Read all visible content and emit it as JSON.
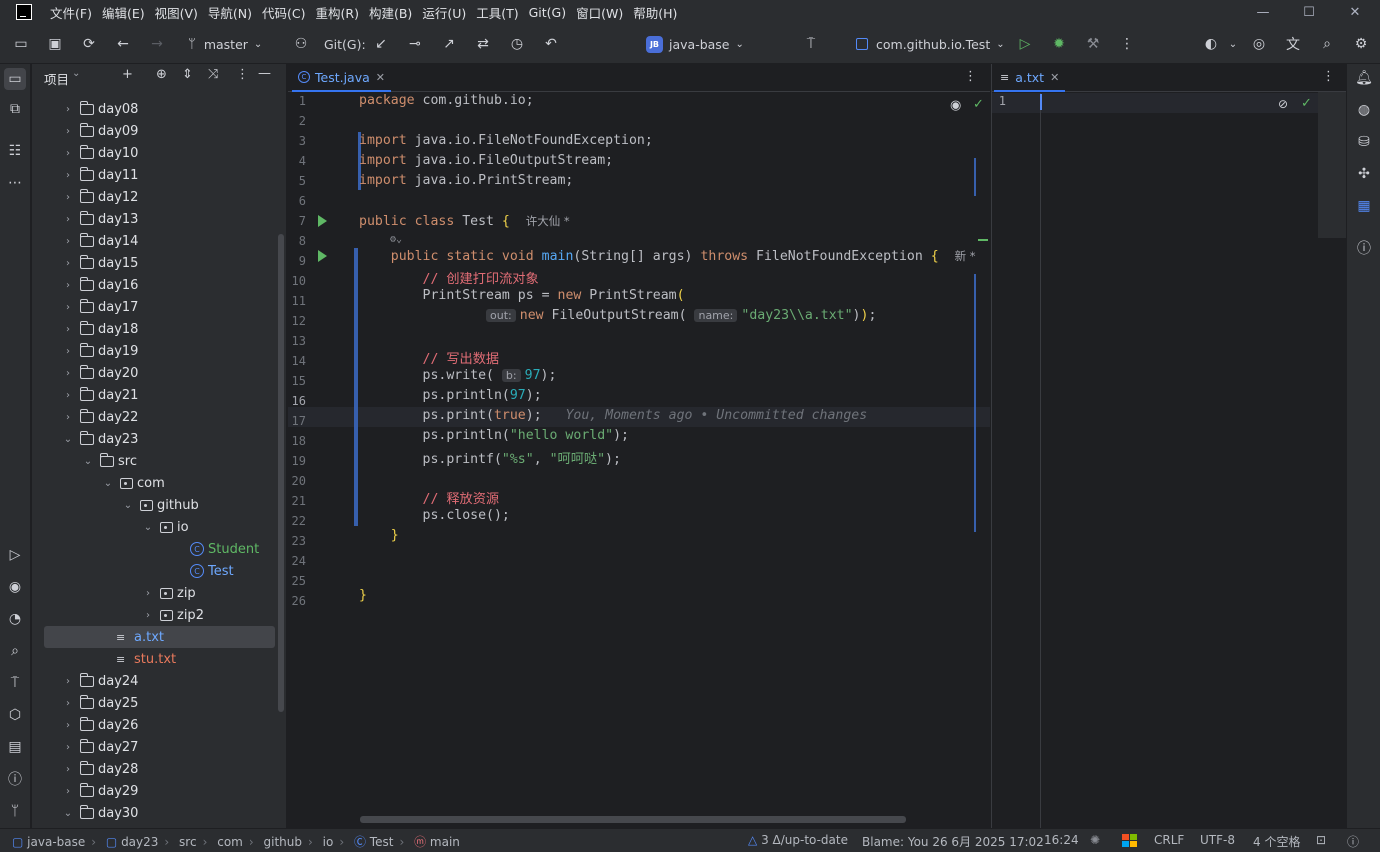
{
  "menu": [
    "文件(F)",
    "编辑(E)",
    "视图(V)",
    "导航(N)",
    "代码(C)",
    "重构(R)",
    "构建(B)",
    "运行(U)",
    "工具(T)",
    "Git(G)",
    "窗口(W)",
    "帮助(H)"
  ],
  "toolbar": {
    "branch": "master",
    "git_label": "Git(G):",
    "project": "java-base",
    "project_badge": "JB",
    "run_config": "com.github.io.Test"
  },
  "project_panel": {
    "title": "项目",
    "rows": [
      {
        "label": "day08",
        "kind": "folder",
        "chev": "›"
      },
      {
        "label": "day09",
        "kind": "folder",
        "chev": "›"
      },
      {
        "label": "day10",
        "kind": "folder",
        "chev": "›"
      },
      {
        "label": "day11",
        "kind": "folder",
        "chev": "›"
      },
      {
        "label": "day12",
        "kind": "folder",
        "chev": "›"
      },
      {
        "label": "day13",
        "kind": "folder",
        "chev": "›"
      },
      {
        "label": "day14",
        "kind": "folder",
        "chev": "›"
      },
      {
        "label": "day15",
        "kind": "folder",
        "chev": "›"
      },
      {
        "label": "day16",
        "kind": "folder",
        "chev": "›"
      },
      {
        "label": "day17",
        "kind": "folder",
        "chev": "›"
      },
      {
        "label": "day18",
        "kind": "folder",
        "chev": "›"
      },
      {
        "label": "day19",
        "kind": "folder",
        "chev": "›"
      },
      {
        "label": "day20",
        "kind": "folder",
        "chev": "›"
      },
      {
        "label": "day21",
        "kind": "folder",
        "chev": "›"
      },
      {
        "label": "day22",
        "kind": "folder",
        "chev": "›"
      },
      {
        "label": "day23",
        "kind": "folder",
        "chev": "⌄"
      },
      {
        "label": "src",
        "kind": "folder",
        "chev": "⌄"
      },
      {
        "label": "com",
        "kind": "package",
        "chev": "⌄"
      },
      {
        "label": "github",
        "kind": "package",
        "chev": "⌄"
      },
      {
        "label": "io",
        "kind": "package",
        "chev": "⌄"
      },
      {
        "label": "Student",
        "kind": "class",
        "chev": ""
      },
      {
        "label": "Test",
        "kind": "class",
        "chev": ""
      },
      {
        "label": "zip",
        "kind": "package",
        "chev": "›"
      },
      {
        "label": "zip2",
        "kind": "package",
        "chev": "›"
      },
      {
        "label": "a.txt",
        "kind": "text",
        "chev": ""
      },
      {
        "label": "stu.txt",
        "kind": "text",
        "chev": ""
      },
      {
        "label": "day24",
        "kind": "folder",
        "chev": "›"
      },
      {
        "label": "day25",
        "kind": "folder",
        "chev": "›"
      },
      {
        "label": "day26",
        "kind": "folder",
        "chev": "›"
      },
      {
        "label": "day27",
        "kind": "folder",
        "chev": "›"
      },
      {
        "label": "day28",
        "kind": "folder",
        "chev": "›"
      },
      {
        "label": "day29",
        "kind": "folder",
        "chev": "›"
      },
      {
        "label": "day30",
        "kind": "folder",
        "chev": "⌄"
      }
    ]
  },
  "editor": {
    "tab": "Test.java",
    "author_hint": "许大仙 *",
    "new_hint": "新 *",
    "line_numbers": [
      "1",
      "2",
      "3",
      "4",
      "5",
      "6",
      "7",
      "8",
      "9",
      "10",
      "11",
      "12",
      "13",
      "14",
      "15",
      "16",
      "17",
      "18",
      "19",
      "20",
      "21",
      "22",
      "23",
      "24",
      "25",
      "26"
    ],
    "current_line": "16",
    "blame_inline": "You, Moments ago • Uncommitted changes",
    "hint_out": "out:",
    "hint_name": "name:",
    "hint_b": "b:",
    "comment1": "// 创建打印流对象",
    "comment2": "// 写出数据",
    "comment3": "// 释放资源",
    "str_path": "\"day23\\\\a.txt\"",
    "str_hello": "\"hello world\"",
    "str_fmt": "\"%s\"",
    "str_cn": "\"呵呵哒\""
  },
  "split_editor": {
    "tab": "a.txt",
    "line_numbers": [
      "1"
    ]
  },
  "statusbar": {
    "breadcrumbs": [
      "java-base",
      "day23",
      "src",
      "com",
      "github",
      "io",
      "Test",
      "main"
    ],
    "vcs": "3 Δ/up-to-date",
    "blame": "Blame: You 26 6月 2025 17:02",
    "position": "16:24",
    "line_sep": "CRLF",
    "encoding": "UTF-8",
    "indent": "4 个空格"
  }
}
